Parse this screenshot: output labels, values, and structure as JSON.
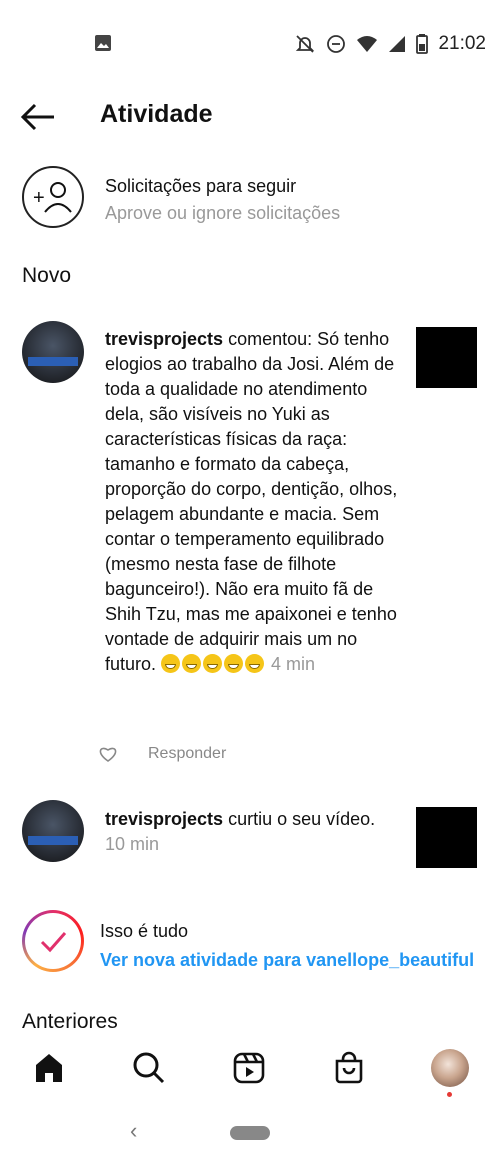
{
  "status_bar": {
    "time": "21:02",
    "icons": [
      "image-notification-icon",
      "mute-icon",
      "dnd-icon",
      "wifi-icon",
      "signal-icon",
      "battery-icon"
    ]
  },
  "header": {
    "title": "Atividade",
    "back_icon": "arrow-left-icon"
  },
  "follow_requests": {
    "title": "Solicitações para seguir",
    "subtitle": "Aprove ou ignore solicitações"
  },
  "sections": {
    "new": "Novo",
    "earlier": "Anteriores"
  },
  "notifications": [
    {
      "username": "trevisprojects",
      "text": " comentou: Só tenho elogios ao trabalho da Josi. Além de toda a qualidade no atendimento dela, são visíveis no Yuki as características físicas da raça: tamanho e formato da cabeça, proporção do corpo, dentição, olhos, pelagem abundante e macia. Sem contar o temperamento equilibrado (mesmo nesta fase de filhote bagunceiro!). Não era muito fã de Shih Tzu, mas me apaixonei e tenho vontade de adquirir mais um no futuro. ",
      "time": "4 min",
      "reply_label": "Responder"
    },
    {
      "username": "trevisprojects",
      "text": " curtiu o seu vídeo.",
      "time": "10 min"
    }
  ],
  "all_set": {
    "title": "Isso é tudo",
    "link": "Ver nova atividade para vanellope_beautiful"
  },
  "bottom_nav": [
    "home-icon",
    "search-icon",
    "reels-icon",
    "shop-icon",
    "profile-avatar"
  ],
  "colors": {
    "link": "#2196f3",
    "notification_dot": "#e53935"
  }
}
